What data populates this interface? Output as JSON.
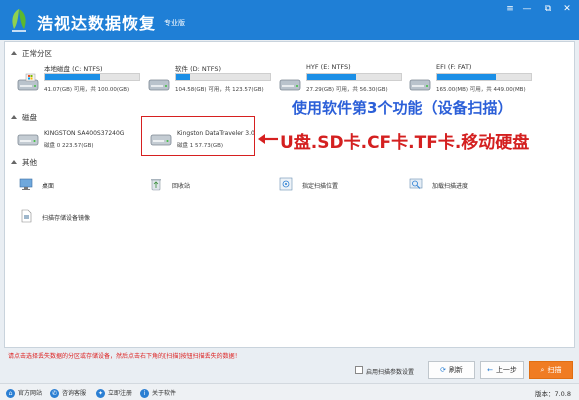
{
  "app": {
    "title": "浩视达数据恢复",
    "edition": "专业版",
    "window_controls": [
      "≡",
      "—",
      "⧉",
      "✕"
    ],
    "accent_color": "#1f7fd6"
  },
  "sections": {
    "partitions_title": "正常分区",
    "disks_title": "磁盘",
    "other_title": "其他"
  },
  "partitions": [
    {
      "name": "本地磁盘 (C: NTFS)",
      "info": "41.07(GB) 可用，共 100.00(GB)",
      "used_fraction": 0.59
    },
    {
      "name": "软件 (D: NTFS)",
      "info": "104.58(GB) 可用，共 123.57(GB)",
      "used_fraction": 0.15
    },
    {
      "name": "HYF (E: NTFS)",
      "info": "27.29(GB) 可用，共 56.30(GB)",
      "used_fraction": 0.52
    },
    {
      "name": "EFI (F: FAT)",
      "info": "165.00(MB) 可用，共 449.00(MB)",
      "used_fraction": 0.63
    }
  ],
  "disks": [
    {
      "name": "KINGSTON SA400S37240G",
      "info": "磁盘 0    223.57(GB)"
    },
    {
      "name": "Kingston DataTraveler 3.0",
      "info": "磁盘 1    57.73(GB)"
    }
  ],
  "annotations": {
    "line1": "使用软件第3个功能（设备扫描）",
    "line2": "U盘.SD卡.CF卡.TF卡.移动硬盘"
  },
  "tools": [
    {
      "label": "桌面",
      "icon": "desktop-icon"
    },
    {
      "label": "回收站",
      "icon": "recycle-bin-icon"
    },
    {
      "label": "指定扫描位置",
      "icon": "target-location-icon"
    },
    {
      "label": "加载扫描进度",
      "icon": "load-progress-icon"
    },
    {
      "label": "扫描存储设备镜像",
      "icon": "disk-image-icon"
    }
  ],
  "status_message": "请点击选择丢失数据的分区或存储设备，然后点击右下角的[扫描]按钮扫描丢失的数据！",
  "controls": {
    "checkbox_label": "启用扫描参数设置",
    "refresh": "刷新",
    "back": "上一步",
    "scan": "扫描"
  },
  "footer": {
    "links": [
      "官方网站",
      "咨询客服",
      "立即注册",
      "关于软件"
    ],
    "version": "版本：7.0.8"
  }
}
